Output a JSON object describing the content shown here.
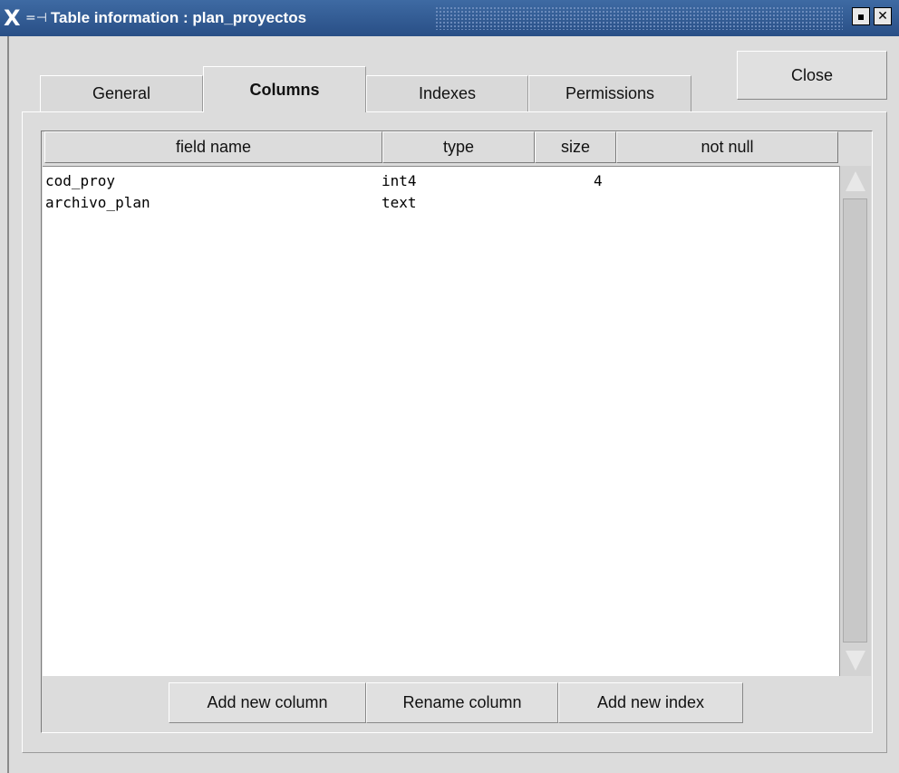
{
  "window": {
    "title": "Table information : plan_proyectos",
    "logo_glyph": "X",
    "title_icon_glyph": "=⊣",
    "minimize_glyph": "▪",
    "close_glyph": "✕"
  },
  "tabs": [
    {
      "label": "General",
      "active": false
    },
    {
      "label": "Columns",
      "active": true
    },
    {
      "label": "Indexes",
      "active": false
    },
    {
      "label": "Permissions",
      "active": false
    }
  ],
  "close_button": "Close",
  "table": {
    "headers": [
      "field name",
      "type",
      "size",
      "not null"
    ],
    "rows": [
      {
        "field_name": "cod_proy",
        "type": "int4",
        "size": "4",
        "not_null": ""
      },
      {
        "field_name": "archivo_plan",
        "type": "text",
        "size": "",
        "not_null": ""
      }
    ]
  },
  "buttons": {
    "add_column": "Add new column",
    "rename_column": "Rename column",
    "add_index": "Add new index"
  },
  "colors": {
    "titlebar": "#294f86",
    "background": "#dcdcdc",
    "list_background": "#ffffff"
  }
}
